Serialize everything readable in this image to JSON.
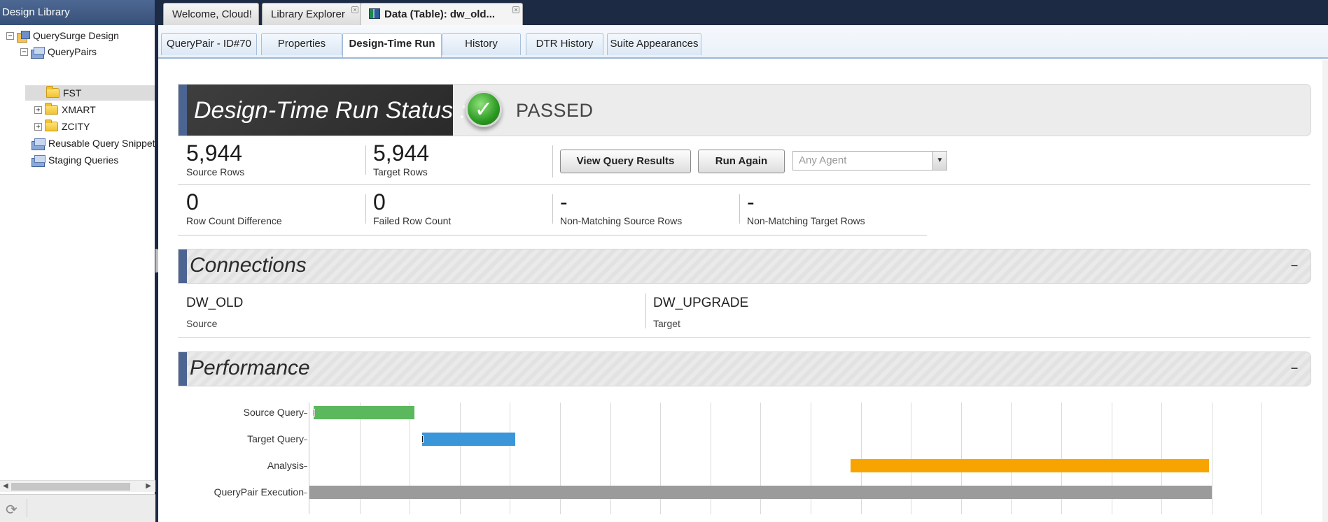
{
  "left_panel": {
    "title": "Design Library",
    "tree": [
      {
        "label": "QuerySurge Design",
        "expander": "−"
      },
      {
        "label": "QueryPairs",
        "expander": "−"
      },
      {
        "label": "FST"
      },
      {
        "label": "XMART",
        "expander": "+"
      },
      {
        "label": "ZCITY",
        "expander": "+"
      },
      {
        "label": "Reusable Query Snippets"
      },
      {
        "label": "Staging Queries"
      }
    ]
  },
  "doc_tabs": [
    {
      "label": "Welcome, Cloud!"
    },
    {
      "label": "Library Explorer",
      "close": "×"
    },
    {
      "label": "Data (Table): dw_old...",
      "close": "×",
      "active": true
    }
  ],
  "sub_tabs": [
    {
      "label": "QueryPair - ID#70"
    },
    {
      "label": "Properties"
    },
    {
      "label": "Design-Time Run",
      "active": true
    },
    {
      "label": "History"
    },
    {
      "label": "DTR History"
    },
    {
      "label": "Suite Appearances"
    }
  ],
  "status": {
    "title": "Design-Time Run Status :",
    "result": "PASSED",
    "check_glyph": "✓",
    "accent_color": "#4c6491"
  },
  "metrics": {
    "source_rows": {
      "value": "5,944",
      "label": "Source Rows"
    },
    "target_rows": {
      "value": "5,944",
      "label": "Target Rows"
    },
    "row_count_difference": {
      "value": "0",
      "label": "Row Count Difference"
    },
    "failed_row_count": {
      "value": "0",
      "label": "Failed Row Count"
    },
    "non_matching_source_rows": {
      "value": "-",
      "label": "Non-Matching Source Rows"
    },
    "non_matching_target_rows": {
      "value": "-",
      "label": "Non-Matching Target Rows"
    }
  },
  "actions": {
    "view_results_label": "View Query Results",
    "run_again_label": "Run Again",
    "agent_select_value": "Any Agent"
  },
  "connections": {
    "title": "Connections",
    "minimize": "–",
    "source": {
      "name": "DW_OLD",
      "role": "Source"
    },
    "target": {
      "name": "DW_UPGRADE",
      "role": "Target"
    }
  },
  "performance": {
    "title": "Performance",
    "minimize": "–"
  },
  "chart_data": {
    "type": "bar",
    "orientation": "horizontal-timeline",
    "categories": [
      "Source Query",
      "Target Query",
      "Analysis",
      "QueryPair Execution"
    ],
    "series": [
      {
        "category": "Source Query",
        "start": 0.08,
        "end": 2.1,
        "color": "#5cb85c"
      },
      {
        "category": "Target Query",
        "start": 2.25,
        "end": 4.1,
        "color": "#3a95d9"
      },
      {
        "category": "Analysis",
        "start": 10.8,
        "end": 17.95,
        "color": "#f7a400"
      },
      {
        "category": "QueryPair Execution",
        "start": 0,
        "end": 18,
        "color": "#9b9b9b"
      }
    ],
    "xlim": [
      0,
      19
    ],
    "grid": true,
    "xlabel": "",
    "ylabel": ""
  }
}
